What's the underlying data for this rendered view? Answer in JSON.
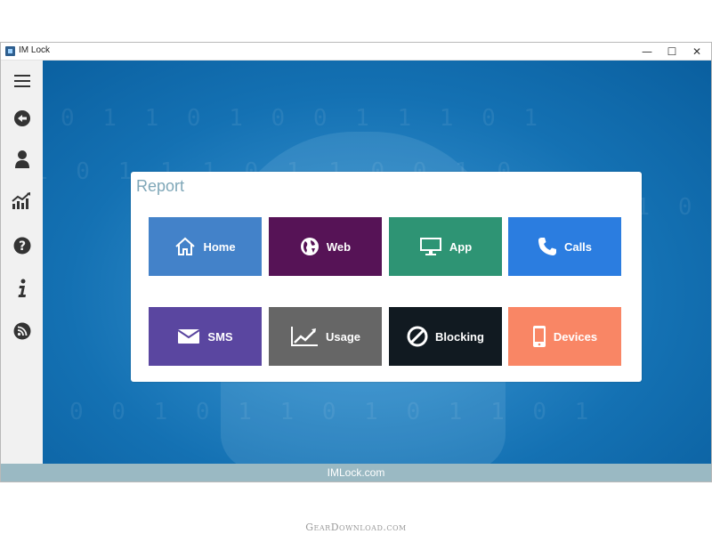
{
  "window": {
    "title": "IM Lock",
    "controls": {
      "minimize": "—",
      "maximize": "☐",
      "close": "✕"
    }
  },
  "sidebar": {
    "items": [
      {
        "icon": "hamburger-menu-icon"
      },
      {
        "icon": "back-arrow-icon"
      },
      {
        "icon": "user-icon"
      },
      {
        "icon": "chart-icon"
      },
      {
        "icon": "help-icon"
      },
      {
        "icon": "info-icon"
      },
      {
        "icon": "rss-icon"
      }
    ]
  },
  "report": {
    "title": "Report",
    "tiles": [
      {
        "label": "Home",
        "icon": "home-icon",
        "color": "#4382c9"
      },
      {
        "label": "Web",
        "icon": "globe-icon",
        "color": "#561356"
      },
      {
        "label": "App",
        "icon": "monitor-icon",
        "color": "#2e9474"
      },
      {
        "label": "Calls",
        "icon": "phone-icon",
        "color": "#2b7de0"
      },
      {
        "label": "SMS",
        "icon": "envelope-icon",
        "color": "#5a46a0"
      },
      {
        "label": "Usage",
        "icon": "line-chart-icon",
        "color": "#666666"
      },
      {
        "label": "Blocking",
        "icon": "block-icon",
        "color": "#111a21"
      },
      {
        "label": "Devices",
        "icon": "mobile-device-icon",
        "color": "#f98665"
      }
    ]
  },
  "statusbar": {
    "text": "IMLock.com"
  },
  "watermark": {
    "text": "GearDownload.com"
  }
}
